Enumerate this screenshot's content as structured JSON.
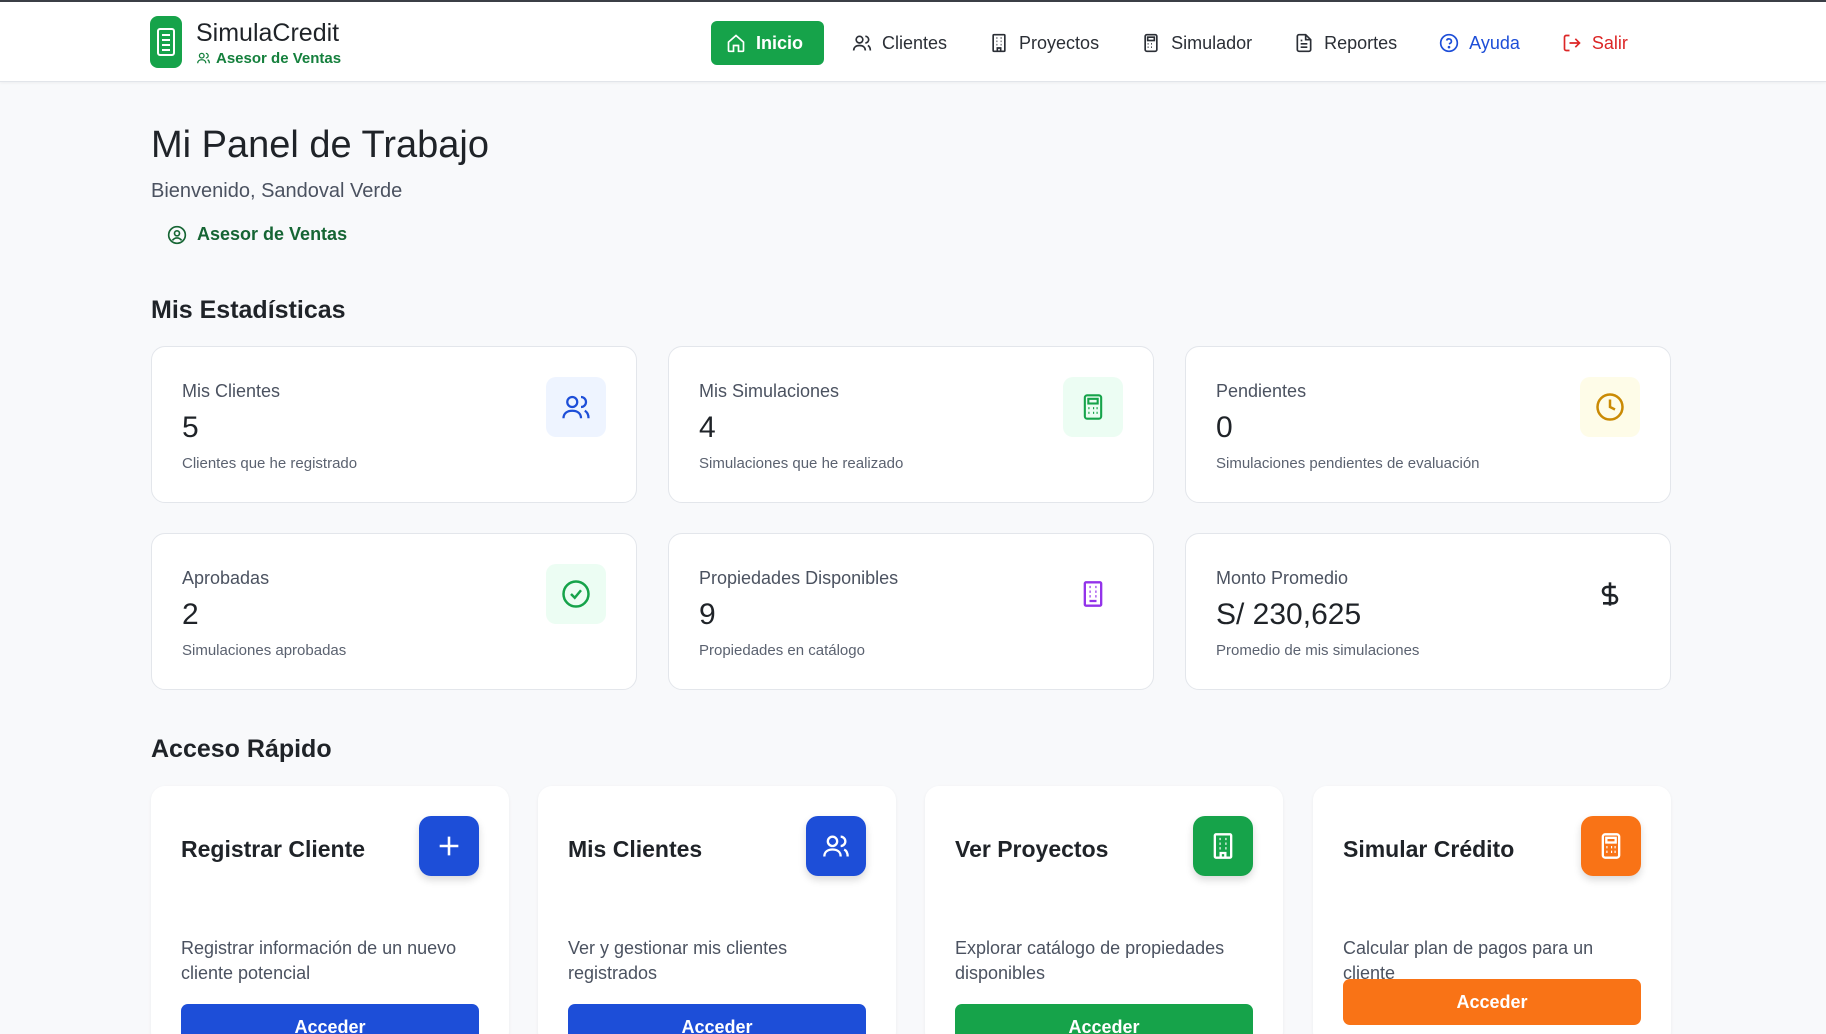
{
  "brand": {
    "title": "SimulaCredit",
    "role": "Asesor de Ventas"
  },
  "nav": {
    "inicio": "Inicio",
    "clientes": "Clientes",
    "proyectos": "Proyectos",
    "simulador": "Simulador",
    "reportes": "Reportes",
    "ayuda": "Ayuda",
    "salir": "Salir"
  },
  "header": {
    "title": "Mi Panel de Trabajo",
    "welcome": "Bienvenido, Sandoval Verde",
    "role": "Asesor de Ventas"
  },
  "stats": {
    "title": "Mis Estadísticas",
    "items": [
      {
        "label": "Mis Clientes",
        "value": "5",
        "desc": "Clientes que he registrado",
        "icon": "users-icon"
      },
      {
        "label": "Mis Simulaciones",
        "value": "4",
        "desc": "Simulaciones que he realizado",
        "icon": "calculator-icon"
      },
      {
        "label": "Pendientes",
        "value": "0",
        "desc": "Simulaciones pendientes de evaluación",
        "icon": "clock-icon"
      },
      {
        "label": "Aprobadas",
        "value": "2",
        "desc": "Simulaciones aprobadas",
        "icon": "check-circle-icon"
      },
      {
        "label": "Propiedades Disponibles",
        "value": "9",
        "desc": "Propiedades en catálogo",
        "icon": "building-icon"
      },
      {
        "label": "Monto Promedio",
        "value": "S/ 230,625",
        "desc": "Promedio de mis simulaciones",
        "icon": "dollar-icon"
      }
    ]
  },
  "quick": {
    "title": "Acceso Rápido",
    "items": [
      {
        "title": "Registrar Cliente",
        "desc": "Registrar información de un nuevo cliente potencial",
        "button": "Acceder",
        "icon": "plus-icon",
        "color": "#1d4ed8"
      },
      {
        "title": "Mis Clientes",
        "desc": "Ver y gestionar mis clientes registrados",
        "button": "Acceder",
        "icon": "users-icon",
        "color": "#1d4ed8"
      },
      {
        "title": "Ver Proyectos",
        "desc": "Explorar catálogo de propiedades disponibles",
        "button": "Acceder",
        "icon": "building-icon",
        "color": "#16a34a"
      },
      {
        "title": "Simular Crédito",
        "desc": "Calcular plan de pagos para un cliente",
        "button": "Acceder",
        "icon": "calculator-icon",
        "color": "#f97316"
      }
    ]
  },
  "colors": {
    "green": "#16a34a",
    "blue": "#1d4ed8",
    "orange": "#f97316",
    "amber": "#ca8a04",
    "purple": "#9333ea",
    "red": "#dc2626"
  }
}
